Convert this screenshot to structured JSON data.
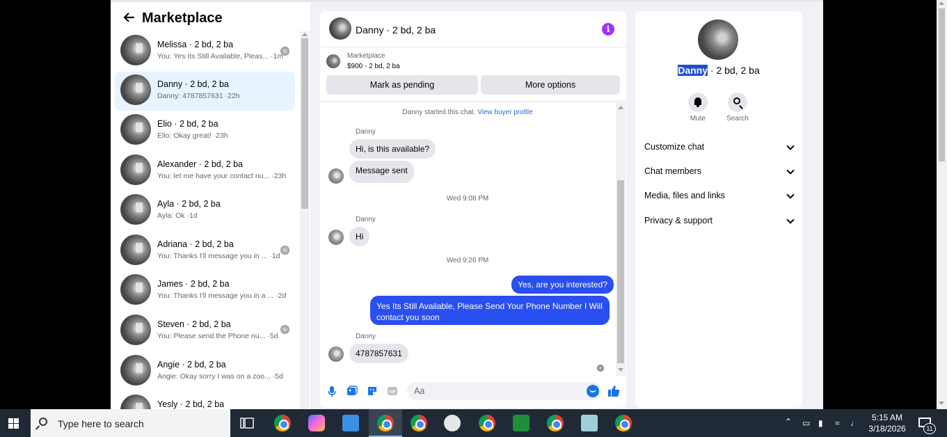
{
  "left_panel": {
    "title": "Marketplace",
    "conversations": [
      {
        "name": "Melissa · 2 bd, 2 ba",
        "snippet": "You: Yes Its Still Available, Pleas... ·1m",
        "active": false,
        "thumb": true
      },
      {
        "name": "Danny · 2 bd, 2 ba",
        "snippet": "Danny: 4787857631 ·22h",
        "active": true,
        "thumb": false
      },
      {
        "name": "Elio · 2 bd, 2 ba",
        "snippet": "Elio: Okay great! ·23h",
        "active": false,
        "thumb": false
      },
      {
        "name": "Alexander · 2 bd, 2 ba",
        "snippet": "You: let me have your contact nu... ·23h",
        "active": false,
        "thumb": false
      },
      {
        "name": "Ayla · 2 bd, 2 ba",
        "snippet": "Ayla: Ok ·1d",
        "active": false,
        "thumb": false
      },
      {
        "name": "Adriana · 2 bd, 2 ba",
        "snippet": "You: Thanks I'll message you in ... ·1d",
        "active": false,
        "thumb": true
      },
      {
        "name": "James · 2 bd, 2 ba",
        "snippet": "You: Thanks I'll message you in a ... ·2d",
        "active": false,
        "thumb": false
      },
      {
        "name": "Steven · 2 bd, 2 ba",
        "snippet": "You: Please send the Phone nu... ·5d",
        "active": false,
        "thumb": true
      },
      {
        "name": "Angie · 2 bd, 2 ba",
        "snippet": "Angie: Okay sorry I was on a zoo... ·5d",
        "active": false,
        "thumb": false
      },
      {
        "name": "Yesly · 2 bd, 2 ba",
        "snippet": "",
        "active": false,
        "thumb": false
      }
    ]
  },
  "chat": {
    "title": "Danny · 2 bd, 2 ba",
    "listing_source": "Marketplace",
    "listing_price": "$900 - 2 bd, 2 ba",
    "btn_pending": "Mark as pending",
    "btn_more": "More options",
    "started_text": "Danny started this chat.",
    "buyer_profile_link": "View buyer profile",
    "sender": "Danny",
    "msg1": "Hi, is this available?",
    "msg2": "Message sent",
    "time1": "Wed 9:08 PM",
    "msg3": "Hi",
    "time2": "Wed 9:26 PM",
    "out1": "Yes, are you interested?",
    "out2_line1": "Yes Its Still Available, Please Send Your Phone Number I Will",
    "out2_line2": "contact you soon",
    "msg4": "4787857631",
    "composer_placeholder": "Aa"
  },
  "right_panel": {
    "name_highlight": "Danny",
    "name_rest": " · 2 bd, 2 ba",
    "mute_label": "Mute",
    "search_label": "Search",
    "menu": [
      "Customize chat",
      "Chat members",
      "Media, files and links",
      "Privacy & support"
    ]
  },
  "taskbar": {
    "search_placeholder": "Type here to search",
    "time": "5:15 AM",
    "date": "3/18/2026",
    "notif_count": "11"
  },
  "colors": {
    "accent_blue": "#2a4ff0",
    "messenger_blue": "#1b74e4",
    "info_purple": "#a033ff",
    "active_row": "#e7f3ff"
  }
}
